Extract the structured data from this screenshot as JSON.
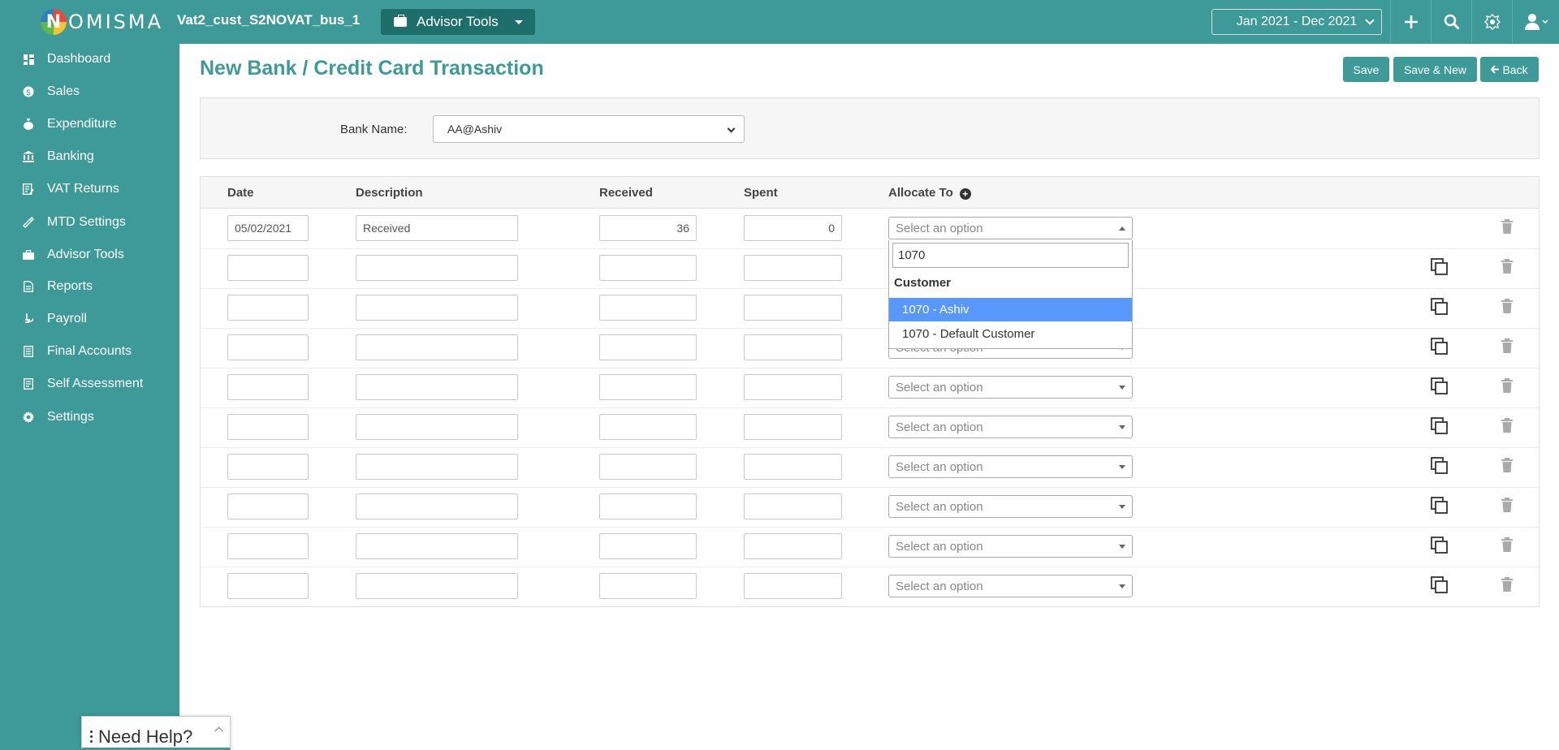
{
  "header": {
    "logo_letter": "N",
    "logo_text": "OMISMA",
    "company": "Vat2_cust_S2NOVAT_bus_1",
    "advisor_tools": "Advisor Tools",
    "period": "Jan 2021 - Dec 2021"
  },
  "sidebar": {
    "items": [
      {
        "label": "Dashboard",
        "icon": "dashboard-icon"
      },
      {
        "label": "Sales",
        "icon": "sales-icon"
      },
      {
        "label": "Expenditure",
        "icon": "expenditure-icon"
      },
      {
        "label": "Banking",
        "icon": "bank-icon"
      },
      {
        "label": "VAT Returns",
        "icon": "vat-returns-icon"
      },
      {
        "label": "MTD Settings",
        "icon": "mtd-settings-icon"
      },
      {
        "label": "Advisor Tools",
        "icon": "briefcase-icon"
      },
      {
        "label": "Reports",
        "icon": "reports-icon"
      },
      {
        "label": "Payroll",
        "icon": "payroll-icon"
      },
      {
        "label": "Final Accounts",
        "icon": "final-accounts-icon"
      },
      {
        "label": "Self Assessment",
        "icon": "self-assessment-icon"
      },
      {
        "label": "Settings",
        "icon": "gear-icon"
      }
    ]
  },
  "page": {
    "title": "New Bank / Credit Card Transaction",
    "save": "Save",
    "save_new": "Save & New",
    "back": "Back"
  },
  "bank": {
    "label": "Bank Name:",
    "value": "AA@Ashiv"
  },
  "grid": {
    "headers": {
      "date": "Date",
      "description": "Description",
      "received": "Received",
      "spent": "Spent",
      "allocate": "Allocate To"
    },
    "placeholder": "Select an option",
    "rows": [
      {
        "date": "05/02/2021",
        "description": "Received",
        "received": "36",
        "spent": "0"
      },
      {
        "date": "",
        "description": "",
        "received": "",
        "spent": ""
      },
      {
        "date": "",
        "description": "",
        "received": "",
        "spent": ""
      },
      {
        "date": "",
        "description": "",
        "received": "",
        "spent": ""
      },
      {
        "date": "",
        "description": "",
        "received": "",
        "spent": ""
      },
      {
        "date": "",
        "description": "",
        "received": "",
        "spent": ""
      },
      {
        "date": "",
        "description": "",
        "received": "",
        "spent": ""
      },
      {
        "date": "",
        "description": "",
        "received": "",
        "spent": ""
      },
      {
        "date": "",
        "description": "",
        "received": "",
        "spent": ""
      },
      {
        "date": "",
        "description": "",
        "received": "",
        "spent": ""
      }
    ]
  },
  "dropdown": {
    "search": "1070",
    "group": "Customer",
    "options": [
      "1070 - Ashiv",
      "1070 - Default Customer"
    ]
  },
  "help": {
    "label": "Need Help?"
  },
  "colors": {
    "brand": "#3d9a99",
    "highlight": "#5897fb"
  }
}
